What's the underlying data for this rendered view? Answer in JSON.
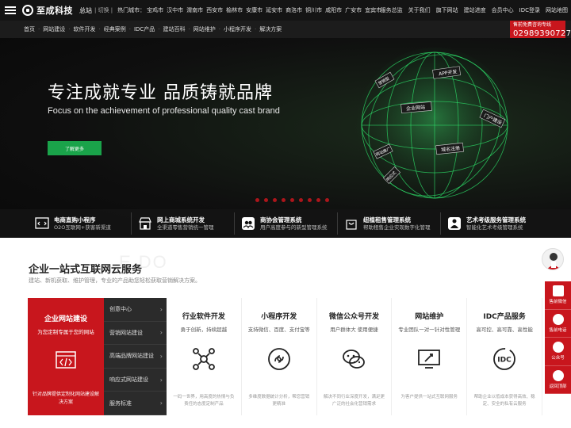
{
  "topbar": {
    "logo": "至成科技",
    "station": "总站",
    "switch": "| 切换 |",
    "hot_label": "热门城市：",
    "cities": [
      "宝鸡市",
      "汉中市",
      "渭南市",
      "西安市",
      "榆林市",
      "安康市",
      "延安市",
      "商洛市",
      "铜川市",
      "咸阳市",
      "广安市",
      "宜宾市"
    ],
    "right_links": [
      "服务总监",
      "关于我们",
      "旗下网站",
      "建站进度",
      "会员中心",
      "IDC登录",
      "网站地图"
    ]
  },
  "nav": {
    "items": [
      "首页",
      "网站建设",
      "软件开发",
      "经典案例",
      "IDC产品",
      "建站百科",
      "网站维护",
      "小程序开发",
      "解决方案"
    ]
  },
  "hotline": {
    "label": "售前免费咨询专线",
    "number": "02989390727"
  },
  "banner": {
    "title": "专注成就专业  品质铸就品牌",
    "subtitle": "Focus on the achievement of professional quality cast brand",
    "button": "了解更多",
    "globe_tags": [
      "APP开发",
      "企业网站",
      "门户建设",
      "域名注册",
      "网站推广",
      "营销型",
      "响应式"
    ],
    "slide_count": 9
  },
  "features": [
    {
      "title": "电商直购小程序",
      "sub": "O2O互联网+获客新渠道"
    },
    {
      "title": "网上商城系统开发",
      "sub": "全渠道零售营销统一管理"
    },
    {
      "title": "商协会管理系统",
      "sub": "用户高度参与的新型管理系统"
    },
    {
      "title": "纽植租售管理系统",
      "sub": "帮助租售企业实现数字化管理"
    },
    {
      "title": "艺术考级服务管理系统",
      "sub": "智能化艺术考级管理系统"
    }
  ],
  "services": {
    "title": "企业一站式互联网云服务",
    "ghost": "E DO",
    "desc": "建站、新机获取、维护管理，专业的产品助您轻松获取营销解决方案。",
    "red_card": {
      "title": "企业网站建设",
      "sub": "为您定制专属于您的网站",
      "foot": "针对品牌提供定制化网站建设解决方案"
    },
    "menu": [
      "创意中心",
      "营销网站建设",
      "高端品牌网站建设",
      "响应式网站建设",
      "服务标准"
    ],
    "columns": [
      {
        "title": "行业软件开发",
        "sub": "勇于创新，持续超越",
        "desc": "一码一世界，用高度的热情与负责任的态度定制产品",
        "icon": "network-icon"
      },
      {
        "title": "小程序开发",
        "sub": "支持微信、百度、支付宝等",
        "desc": "多维度数据统计分析，帮您营销更精准",
        "icon": "miniprogram-icon"
      },
      {
        "title": "微信公众号开发",
        "sub": "用户群体大 使用便捷",
        "desc": "解决不同行业深度开发，满足更广泛的社会化营销需求",
        "icon": "wechat-icon"
      },
      {
        "title": "网站维护",
        "sub": "专业团队一对一针对性管理",
        "desc": "为客户提供一站式互联网服务",
        "icon": "maintenance-icon"
      },
      {
        "title": "IDC产品服务",
        "sub": "高可控、高可靠、高性能",
        "desc": "帮助企业以低成本获得高效、稳定、安全的私有云服务",
        "icon": "idc-icon"
      }
    ]
  },
  "sidebar": {
    "items": [
      "售前微信",
      "售前电话",
      "公众号",
      "返回顶部"
    ]
  }
}
